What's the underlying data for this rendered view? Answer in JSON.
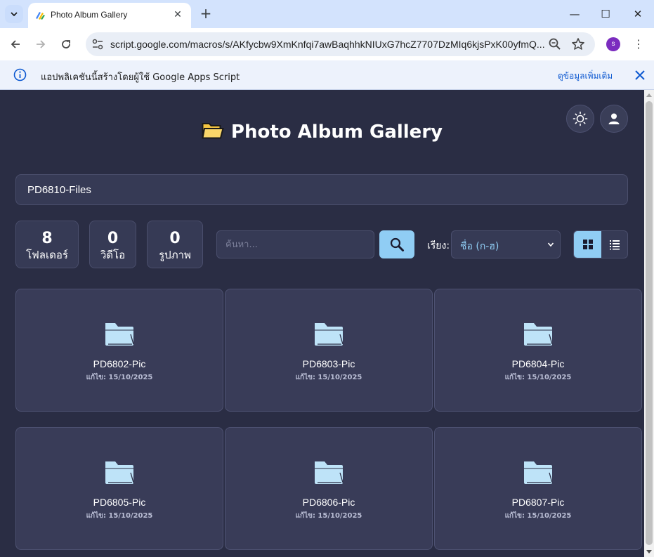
{
  "browser": {
    "tab_title": "Photo Album Gallery",
    "tab_close": "✕",
    "new_tab": "+",
    "url": "script.google.com/macros/s/AKfycbw9XmKnfqi7awBaqhhkNIUxG7hcZ7707DzMIq6kjsPxK00yfmQ...",
    "profile_initial": "s",
    "window_controls": [
      "—",
      "☐",
      "✕"
    ],
    "infobar_text": "แอปพลิเคชันนี้สร้างโดยผู้ใช้ Google Apps Script",
    "infobar_link": "ดูข้อมูลเพิ่มเติม"
  },
  "app": {
    "title": "Photo Album Gallery",
    "breadcrumb": "PD6810-Files",
    "stats": [
      {
        "value": "8",
        "label": "โฟลเดอร์"
      },
      {
        "value": "0",
        "label": "วิดีโอ"
      },
      {
        "value": "0",
        "label": "รูปภาพ"
      }
    ],
    "search_placeholder": "ค้นหา...",
    "sort_label": "เรียง:",
    "sort_value": "ชื่อ (ก-ฮ)",
    "accent_color": "#90cdf4",
    "background_color": "#2a2d44",
    "folders": [
      {
        "name": "PD6802-Pic",
        "modified": "แก้ไข: 15/10/2025"
      },
      {
        "name": "PD6803-Pic",
        "modified": "แก้ไข: 15/10/2025"
      },
      {
        "name": "PD6804-Pic",
        "modified": "แก้ไข: 15/10/2025"
      },
      {
        "name": "PD6805-Pic",
        "modified": "แก้ไข: 15/10/2025"
      },
      {
        "name": "PD6806-Pic",
        "modified": "แก้ไข: 15/10/2025"
      },
      {
        "name": "PD6807-Pic",
        "modified": "แก้ไข: 15/10/2025"
      }
    ]
  }
}
